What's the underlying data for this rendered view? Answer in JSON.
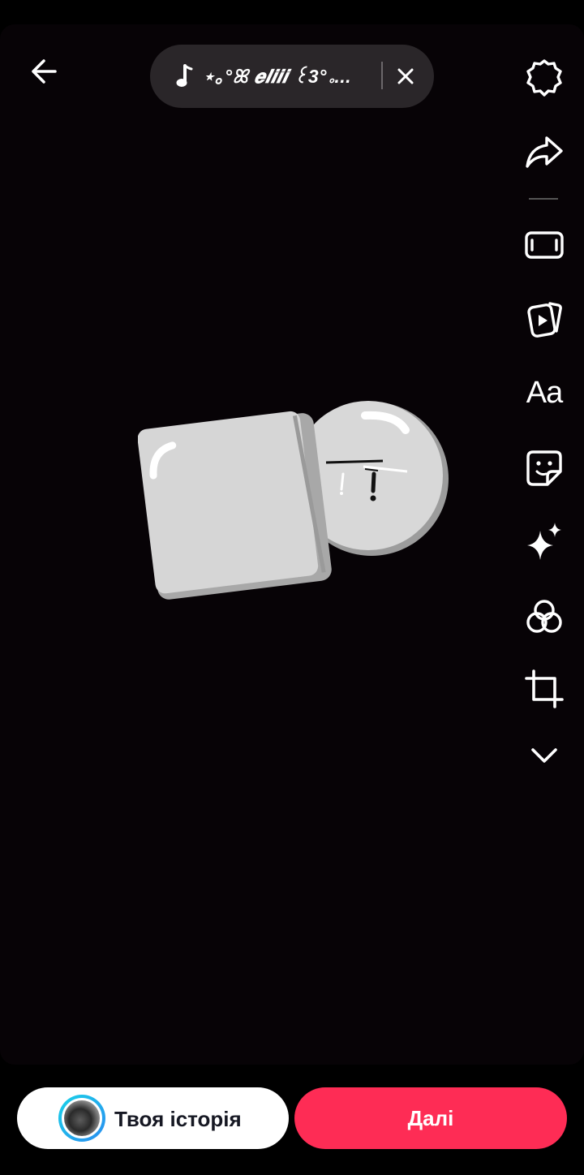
{
  "header": {
    "back_icon": "arrow-left-icon",
    "sound": {
      "icon": "music-note-icon",
      "title": "⋆｡°ꕤ 𝒆𝒍𝒊𝒊𝒊 ꒰3°｡...",
      "close_icon": "close-icon"
    }
  },
  "toolbar": {
    "items": [
      {
        "icon": "settings-gear-icon"
      },
      {
        "icon": "share-arrow-icon"
      },
      {
        "icon": "aspect-ratio-icon"
      },
      {
        "icon": "templates-icon"
      },
      {
        "icon": "text-tool-icon",
        "label": "Aa"
      },
      {
        "icon": "sticker-icon"
      },
      {
        "icon": "effects-sparkle-icon"
      },
      {
        "icon": "filters-icon"
      },
      {
        "icon": "crop-icon"
      },
      {
        "icon": "chevron-down-icon"
      }
    ]
  },
  "bottom": {
    "story_label": "Твоя історія",
    "next_label": "Далі"
  },
  "colors": {
    "background": "#070306",
    "pill": "#2a2629",
    "next": "#fe2c55",
    "story_ring": "#19d3e8"
  }
}
